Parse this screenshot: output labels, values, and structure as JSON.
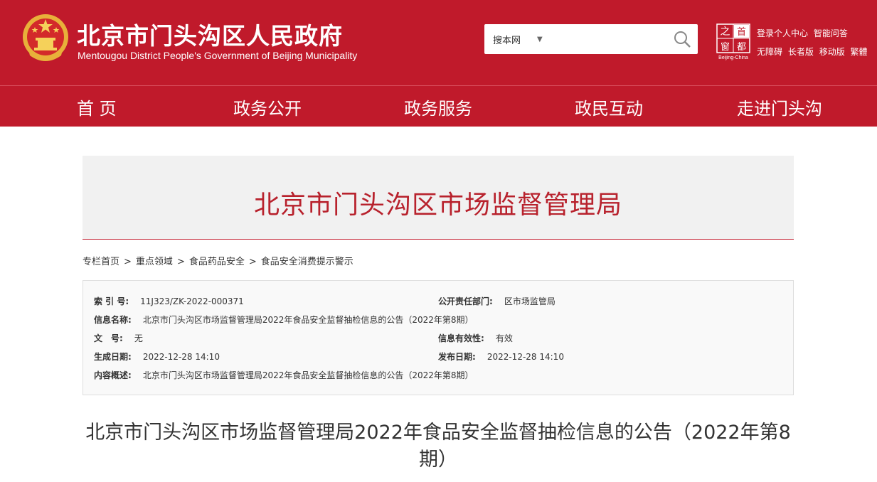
{
  "header": {
    "title": "北京市门头沟区人民政府",
    "subtitle": "Mentougou District People's Government of Beijing Municipality",
    "search": {
      "scope": "搜本网",
      "placeholder": ""
    },
    "capital_logo": {
      "chars": [
        "之",
        "首",
        "窗",
        "都"
      ],
      "caption": "Beijing-China"
    },
    "links_row1": [
      "登录个人中心",
      "智能问答"
    ],
    "links_row2": [
      "无障碍",
      "长者版",
      "移动版",
      "繁體"
    ],
    "brand_color": "#c01a2b"
  },
  "nav": {
    "items": [
      "首 页",
      "政务公开",
      "政务服务",
      "政民互动",
      "走进门头沟"
    ]
  },
  "department": {
    "title": "北京市门头沟区市场监督管理局"
  },
  "breadcrumb": [
    "专栏首页",
    "重点领域",
    "食品药品安全",
    "食品安全消费提示警示"
  ],
  "info": {
    "index_label": "索 引 号:",
    "index_value": "11J323/ZK-2022-000371",
    "dept_label": "公开责任部门:",
    "dept_value": "区市场监管局",
    "name_label": "信息名称:",
    "name_value": "北京市门头沟区市场监督管理局2022年食品安全监督抽检信息的公告（2022年第8期）",
    "docno_label": "文　号:",
    "docno_value": "无",
    "validity_label": "信息有效性:",
    "validity_value": "有效",
    "created_label": "生成日期:",
    "created_value": "2022-12-28 14:10",
    "published_label": "发布日期:",
    "published_value": "2022-12-28 14:10",
    "summary_label": "内容概述:",
    "summary_value": "北京市门头沟区市场监督管理局2022年食品安全监督抽检信息的公告（2022年第8期）"
  },
  "article": {
    "title": "北京市门头沟区市场监督管理局2022年食品安全监督抽检信息的公告（2022年第8期）"
  }
}
